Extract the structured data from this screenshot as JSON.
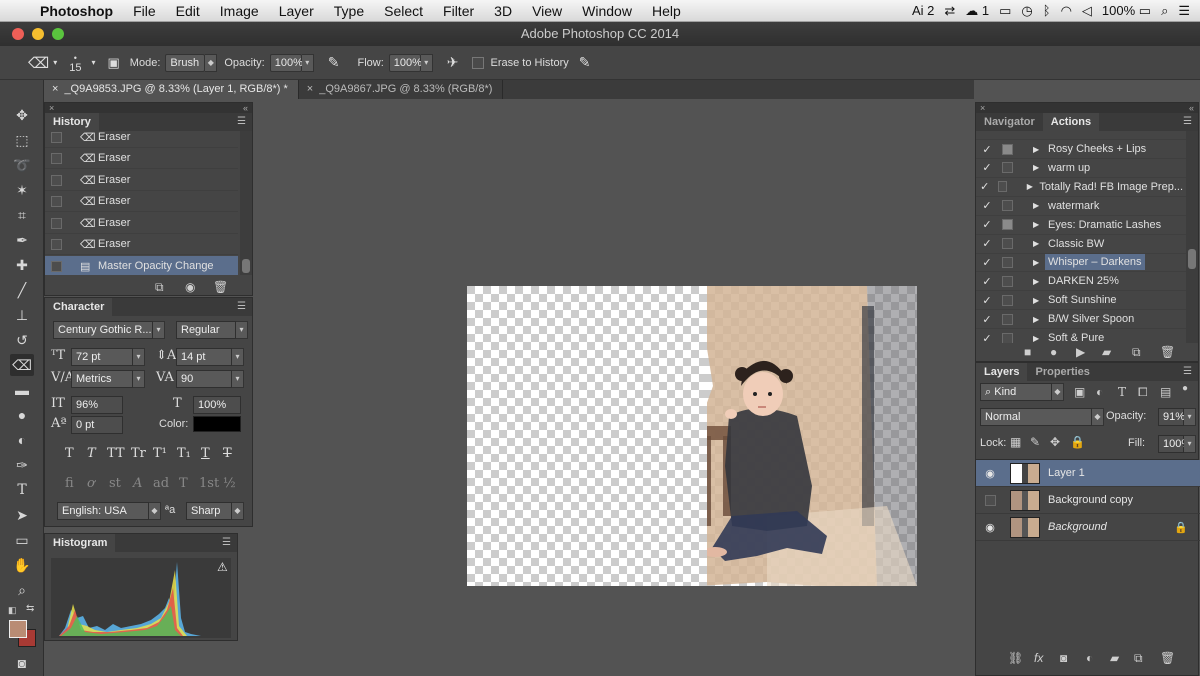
{
  "menubar": {
    "app": "Photoshop",
    "items": [
      "File",
      "Edit",
      "Image",
      "Layer",
      "Type",
      "Select",
      "Filter",
      "3D",
      "View",
      "Window",
      "Help"
    ],
    "status": {
      "ai_count": "2",
      "cc_count": "1",
      "battery": "100%"
    }
  },
  "window": {
    "title": "Adobe Photoshop CC 2014"
  },
  "options": {
    "brush_size": "15",
    "mode_label": "Mode:",
    "mode_value": "Brush",
    "opacity_label": "Opacity:",
    "opacity_value": "100%",
    "flow_label": "Flow:",
    "flow_value": "100%",
    "erase_history_label": "Erase to History"
  },
  "doc_tabs": [
    {
      "label": "_Q9A9853.JPG @ 8.33% (Layer 1, RGB/8*) *"
    },
    {
      "label": "_Q9A9867.JPG @ 8.33% (RGB/8*)"
    }
  ],
  "history": {
    "tab": "History",
    "items": [
      "Eraser",
      "Eraser",
      "Eraser",
      "Eraser",
      "Eraser",
      "Eraser",
      "Master Opacity Change"
    ]
  },
  "character": {
    "tab": "Character",
    "font_family": "Century Gothic R...",
    "font_style": "Regular",
    "font_size": "72 pt",
    "leading": "14 pt",
    "kerning": "Metrics",
    "tracking": "90",
    "vscale": "96%",
    "hscale": "100%",
    "baseline": "0 pt",
    "color_label": "Color:",
    "language": "English: USA",
    "aa_label": "ªa",
    "antialias": "Sharp",
    "style_glyphs": [
      "T",
      "T",
      "TT",
      "Tr",
      "T¹",
      "T₁",
      "T",
      "T"
    ],
    "ot_glyphs": [
      "fi",
      "ơ",
      "st",
      "A",
      "ad",
      "T",
      "1st",
      "½"
    ]
  },
  "histogram": {
    "tab": "Histogram",
    "warning": "⚠"
  },
  "navigator_actions": {
    "tabs": [
      "Navigator",
      "Actions"
    ],
    "items": [
      {
        "name": "Rosy Cheeks + Lips",
        "dialog": true
      },
      {
        "name": "warm up",
        "dialog": false
      },
      {
        "name": "Totally Rad! FB Image Prep...",
        "dialog": false
      },
      {
        "name": "watermark",
        "dialog": false
      },
      {
        "name": "Eyes: Dramatic Lashes",
        "dialog": true
      },
      {
        "name": "Classic BW",
        "dialog": false
      },
      {
        "name": "Whisper – Darkens",
        "dialog": false
      },
      {
        "name": "DARKEN 25%",
        "dialog": false
      },
      {
        "name": "Soft Sunshine",
        "dialog": false
      },
      {
        "name": "B/W Silver Spoon",
        "dialog": false
      },
      {
        "name": "Soft & Pure",
        "dialog": false
      }
    ]
  },
  "layers": {
    "tabs": [
      "Layers",
      "Properties"
    ],
    "filter": "Kind",
    "blend_mode": "Normal",
    "opacity_label": "Opacity:",
    "opacity": "91%",
    "lock_label": "Lock:",
    "fill_label": "Fill:",
    "fill": "100%",
    "items": [
      {
        "name": "Layer 1",
        "visible": true
      },
      {
        "name": "Background copy",
        "visible": false
      },
      {
        "name": "Background",
        "visible": true
      }
    ]
  },
  "colors": {
    "accent": "#5b6e8c",
    "foreground": "#b98c74",
    "background": "#a83a34"
  }
}
